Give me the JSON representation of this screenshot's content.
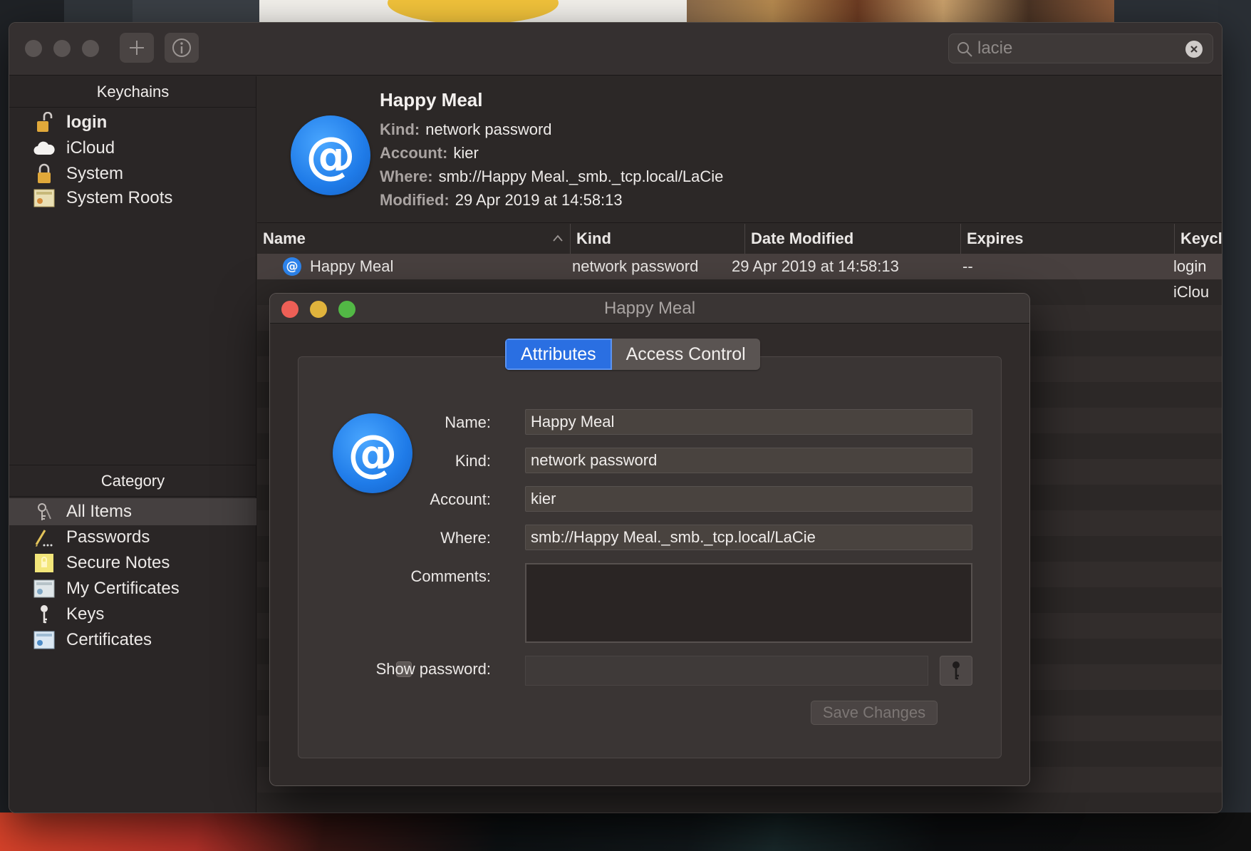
{
  "search": {
    "value": "lacie"
  },
  "sidebar": {
    "keychains_header": "Keychains",
    "keychains": [
      {
        "label": "login",
        "icon": "unlocked-padlock-icon",
        "bold": true
      },
      {
        "label": "iCloud",
        "icon": "cloud-icon"
      },
      {
        "label": "System",
        "icon": "padlock-icon"
      },
      {
        "label": "System Roots",
        "icon": "certificate-icon"
      }
    ],
    "category_header": "Category",
    "categories": [
      {
        "label": "All Items",
        "icon": "all-items-icon",
        "selected": true
      },
      {
        "label": "Passwords",
        "icon": "pen-icon"
      },
      {
        "label": "Secure Notes",
        "icon": "secure-note-icon"
      },
      {
        "label": "My Certificates",
        "icon": "my-certificate-icon"
      },
      {
        "label": "Keys",
        "icon": "key-icon"
      },
      {
        "label": "Certificates",
        "icon": "certificate-icon"
      }
    ]
  },
  "detail": {
    "title": "Happy Meal",
    "icon": "at-sign-icon",
    "kind_label": "Kind:",
    "kind": "network password",
    "account_label": "Account:",
    "account": "kier",
    "where_label": "Where:",
    "where": "smb://Happy Meal._smb._tcp.local/LaCie",
    "modified_label": "Modified:",
    "modified": "29 Apr 2019 at 14:58:13"
  },
  "table": {
    "columns": [
      "Name",
      "Kind",
      "Date Modified",
      "Expires",
      "Keycl"
    ],
    "rows": [
      {
        "name": "Happy Meal",
        "kind": "network password",
        "date": "29 Apr 2019 at 14:58:13",
        "expires": "--",
        "keychain": "login"
      },
      {
        "name": "",
        "kind": "",
        "date": "",
        "expires": "",
        "keychain": "iClou"
      }
    ]
  },
  "sheet": {
    "title": "Happy Meal",
    "tabs": [
      "Attributes",
      "Access Control"
    ],
    "active_tab": "Attributes",
    "fields": {
      "name_label": "Name:",
      "name": "Happy Meal",
      "kind_label": "Kind:",
      "kind": "network password",
      "account_label": "Account:",
      "account": "kier",
      "where_label": "Where:",
      "where": "smb://Happy Meal._smb._tcp.local/LaCie",
      "comments_label": "Comments:",
      "comments": "",
      "show_password_label": "Show password:"
    },
    "save_label": "Save Changes"
  },
  "colors": {
    "accent": "#2a6fe2",
    "close": "#ed5f56",
    "minimize": "#e0b33c",
    "zoom": "#52b845"
  }
}
